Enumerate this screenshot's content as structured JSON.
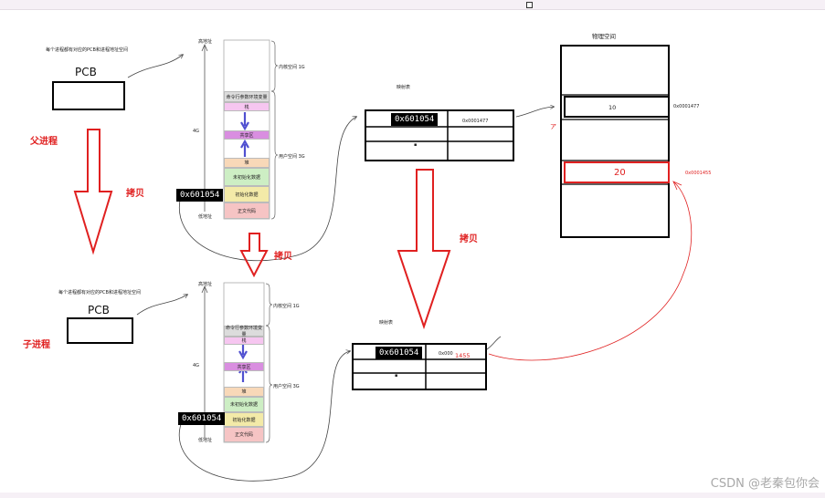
{
  "parent": {
    "label": "父进程",
    "note": "每个进程都有对应的PCB和进程地址空间",
    "pcb": "PCB",
    "address": "0x601054",
    "mem": {
      "high": "高地址",
      "low": "低地址",
      "size": "4G",
      "kernel": "内核空间 1G",
      "user": "用户空间 3G",
      "segments": [
        "命令行参数环境变量",
        "栈",
        "共享区",
        "堆",
        "未初始化数据",
        "初始化数据",
        "正文代码"
      ]
    },
    "map": {
      "title": "映射表",
      "virt": "0x601054",
      "phys": "0x0001477",
      "dot": "▪"
    }
  },
  "child": {
    "label": "子进程",
    "note": "每个进程都有对应的PCB和进程地址空间",
    "pcb": "PCB",
    "address": "0x601054",
    "mem": {
      "high": "高地址",
      "low": "低地址",
      "size": "4G",
      "kernel": "内核空间 1G",
      "user": "用户空间 3G",
      "segments": [
        "命令行参数环境变量",
        "栈",
        "共享区",
        "堆",
        "未初始化数据",
        "初始化数据",
        "正文代码"
      ]
    },
    "map": {
      "title": "映射表",
      "virt": "0x601054",
      "phys": "0x000",
      "phys_new": "1455",
      "dot": "▪"
    }
  },
  "copy_labels": [
    "拷贝",
    "拷贝",
    "拷贝"
  ],
  "physical": {
    "title": "物理空间",
    "cells": [
      {
        "value": "10",
        "addr": "0x0001477"
      },
      {
        "value": "20",
        "addr": "0x0001455"
      }
    ]
  },
  "watermark": "CSDN @老秦包你会",
  "colors": {
    "red": "#e02020",
    "stack": "#f6c6f0",
    "shared": "#d98ee0",
    "heap": "#f8d8b8",
    "bss": "#cdeec4",
    "data": "#f3eaa8",
    "text": "#f6c4c4"
  }
}
